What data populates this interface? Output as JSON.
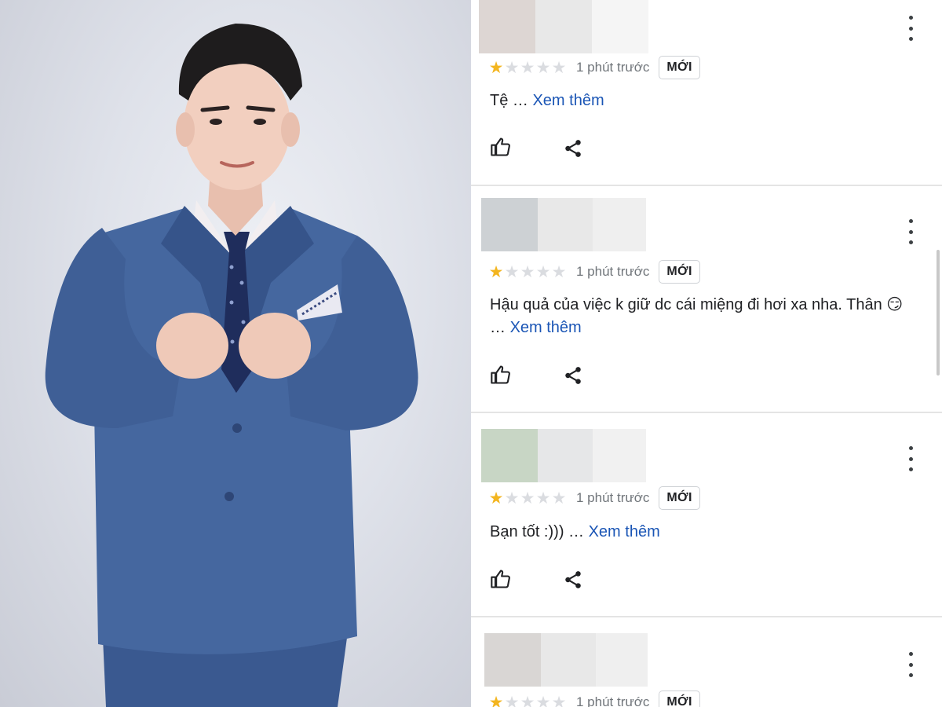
{
  "photo": {
    "icon": "portrait-photo",
    "background": "#dfe2ea",
    "suit_color": "#3f5f9a",
    "tie_color": "#1f2d5c"
  },
  "reviews": [
    {
      "rating": 1,
      "time": "1 phút trước",
      "badge": "MỚI",
      "text": "Tệ …",
      "more": "Xem thêm",
      "blur_colors": [
        "#ddd6d3",
        "#e8e8e8",
        "#f5f5f5"
      ]
    },
    {
      "rating": 1,
      "time": "1 phút trước",
      "badge": "MỚI",
      "text": "Hậu quả của việc k giữ dc cái miệng đi hơi xa nha. Thân 😏",
      "text_line2": "…",
      "more": "Xem thêm",
      "blur_colors": [
        "#cdd1d4",
        "#e8e8e8",
        "#efefef"
      ]
    },
    {
      "rating": 1,
      "time": "1 phút trước",
      "badge": "MỚI",
      "text": "Bạn tốt :))) …",
      "more": "Xem thêm",
      "blur_colors": [
        "#c8d6c5",
        "#e6e7e8",
        "#f1f1f1"
      ]
    },
    {
      "rating": 1,
      "time": "1 phút trước",
      "badge": "MỚI",
      "blur_colors": [
        "#d9d6d4",
        "#e8e8e8",
        "#efefef"
      ]
    }
  ],
  "icons": {
    "like": "thumbs-up-icon",
    "share": "share-icon",
    "menu": "more-vertical-icon"
  },
  "colors": {
    "star_filled": "#f3b51f",
    "star_empty": "#dadce0",
    "link": "#1a55b5"
  }
}
